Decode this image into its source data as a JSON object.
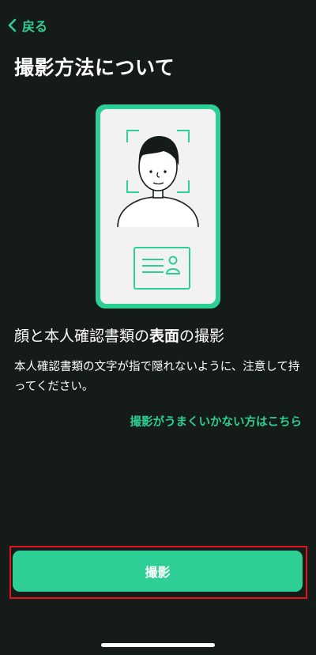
{
  "nav": {
    "back_label": "戻る"
  },
  "page": {
    "title": "撮影方法について"
  },
  "instruction": {
    "heading_prefix": "顔と本人確認書類の",
    "heading_bold": "表面",
    "heading_suffix": "の撮影",
    "description": "本人確認書類の文字が指で隠れないように、注意して持ってください。",
    "help_link": "撮影がうまくいかない方はこちら"
  },
  "actions": {
    "capture_label": "撮影"
  },
  "colors": {
    "background": "#151b19",
    "accent": "#2ecf94",
    "highlight_border": "#e0141e"
  },
  "illustration": {
    "icons": [
      "face-illustration",
      "id-card-icon"
    ]
  }
}
